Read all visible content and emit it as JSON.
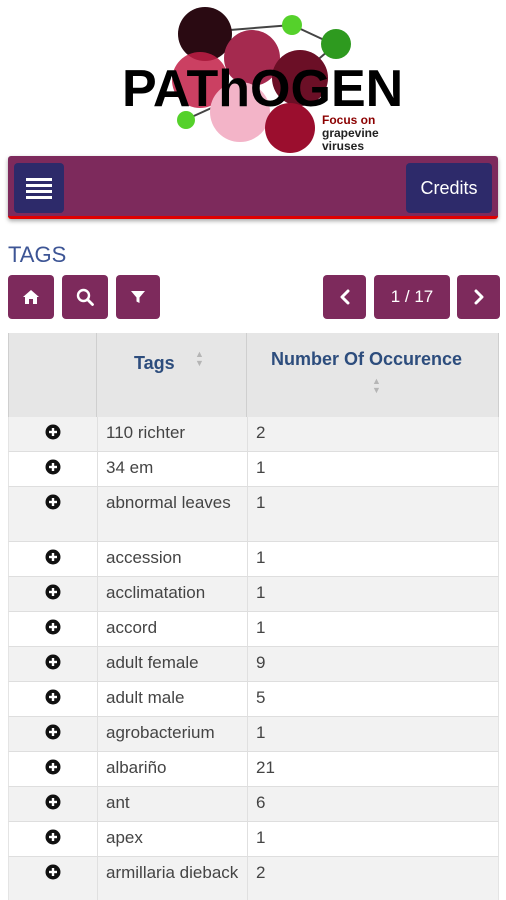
{
  "logo": {
    "title": "PAThOGEN",
    "tagline_1": "Focus on",
    "tagline_2": "grapevine",
    "tagline_3": "viruses"
  },
  "navbar": {
    "menu_icon": "hamburger-icon",
    "credits_label": "Credits"
  },
  "page": {
    "title": "TAGS"
  },
  "toolbar": {
    "home_icon": "home-icon",
    "search_icon": "search-icon",
    "filter_icon": "filter-icon",
    "prev_icon": "chevron-left-icon",
    "pagination": "1 / 17",
    "next_icon": "chevron-right-icon"
  },
  "table": {
    "columns": [
      "Tags",
      "Number Of Occurence"
    ],
    "rows": [
      {
        "tag": "110 richter",
        "count": "2"
      },
      {
        "tag": "34 em",
        "count": "1"
      },
      {
        "tag": "abnormal leaves",
        "count": "1"
      },
      {
        "tag": "accession",
        "count": "1"
      },
      {
        "tag": "acclimatation",
        "count": "1"
      },
      {
        "tag": "accord",
        "count": "1"
      },
      {
        "tag": "adult female",
        "count": "9"
      },
      {
        "tag": "adult male",
        "count": "5"
      },
      {
        "tag": "agrobacterium",
        "count": "1"
      },
      {
        "tag": "albariño",
        "count": "21"
      },
      {
        "tag": "ant",
        "count": "6"
      },
      {
        "tag": "apex",
        "count": "1"
      },
      {
        "tag": "armillaria dieback",
        "count": "2"
      }
    ]
  },
  "colors": {
    "brand": "#7d2a5c",
    "button_dark": "#2d2a6a",
    "title_blue": "#3d5595",
    "header_blue": "#2d4d7d"
  }
}
